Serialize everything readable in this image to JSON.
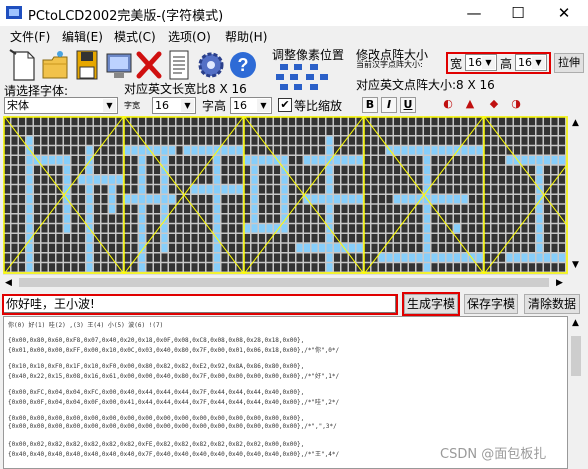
{
  "window": {
    "title": "PCtoLCD2002完美版-(字符模式)",
    "minimize": "—",
    "maximize": "☐",
    "close": "✕"
  },
  "menu": [
    "文件(F)",
    "编辑(E)",
    "模式(C)",
    "选项(O)",
    "帮助(H)"
  ],
  "toolbar": {
    "adjust_pixel_label": "调整像素位置",
    "modify_dot_label": "修改点阵大小",
    "current_hanzi_size_label": "当前汉字点阵大小:",
    "width_label": "宽",
    "width_value": "16",
    "height_label": "高",
    "height_value": "16",
    "stretch_label": "拉伸",
    "ascii_size_label": "对应英文点阵大小:8 X 16",
    "select_font_label": "请选择字体:",
    "ascii_width_label": "对应英文长宽比8 X 16",
    "font_value": "宋体",
    "char_width_label": "字宽",
    "char_width_value": "16",
    "char_height_label": "字高",
    "char_height_value": "16",
    "proportional_label": "等比缩放",
    "proportional_checked": true,
    "bold_label": "B",
    "italic_label": "I",
    "underline_label": "U"
  },
  "dot_matrix": {
    "rows": 16,
    "cols": 75,
    "on_color": "#87cefa",
    "off_color": "#333333",
    "bg_color": "#c8c8c8",
    "guide_color": "#ffff00",
    "char_count": 4.6
  },
  "input": {
    "text": "你好哇，王小波!",
    "generate_button": "生成字模",
    "save_button": "保存字模",
    "clear_button": "清除数据"
  },
  "output": {
    "index_line": "你(0) 好(1) 哇(2) ,(3) 王(4) 小(5) 波(6) !(7)",
    "blocks": [
      [
        "{0x00,0x80,0x60,0xF8,0x07,0x40,0x20,0x18,0x0F,0x08,0xC8,0x08,0x08,0x28,0x18,0x00},",
        "{0x01,0x00,0x00,0xFF,0x00,0x10,0x0C,0x03,0x40,0x80,0x7F,0x00,0x01,0x06,0x18,0x00},/*\"你\",0*/"
      ],
      [
        "{0x10,0x10,0xF0,0x1F,0x10,0xF0,0x00,0x80,0x82,0x82,0xE2,0x92,0x8A,0x86,0x80,0x00},",
        "{0x40,0x22,0x15,0x08,0x16,0x61,0x00,0x00,0x40,0x80,0x7F,0x00,0x00,0x00,0x00,0x00},/*\"好\",1*/"
      ],
      [
        "{0x00,0xFC,0x04,0x04,0xFC,0x00,0x40,0x44,0x44,0x44,0x7F,0x44,0x44,0x44,0x40,0x00},",
        "{0x00,0x0F,0x04,0x04,0x0F,0x00,0x41,0x44,0x44,0x44,0x7F,0x44,0x44,0x44,0x40,0x00},/*\"哇\",2*/"
      ],
      [
        "{0x00,0x00,0x00,0x00,0x00,0x00,0x00,0x00,0x00,0x00,0x00,0x00,0x00,0x00,0x00,0x00},",
        "{0x00,0x00,0x00,0x00,0x00,0x00,0x00,0x00,0x00,0x00,0x00,0x00,0x00,0x00,0x00,0x00},/*\",\",3*/"
      ],
      [
        "{0x00,0x02,0x82,0x82,0x82,0x82,0x82,0xFE,0x82,0x82,0x82,0x82,0x82,0x02,0x00,0x00},",
        "{0x40,0x40,0x40,0x40,0x40,0x40,0x40,0x7F,0x40,0x40,0x40,0x40,0x40,0x40,0x40,0x00},/*\"王\",4*/"
      ]
    ]
  },
  "watermark": "CSDN @面包板扎"
}
